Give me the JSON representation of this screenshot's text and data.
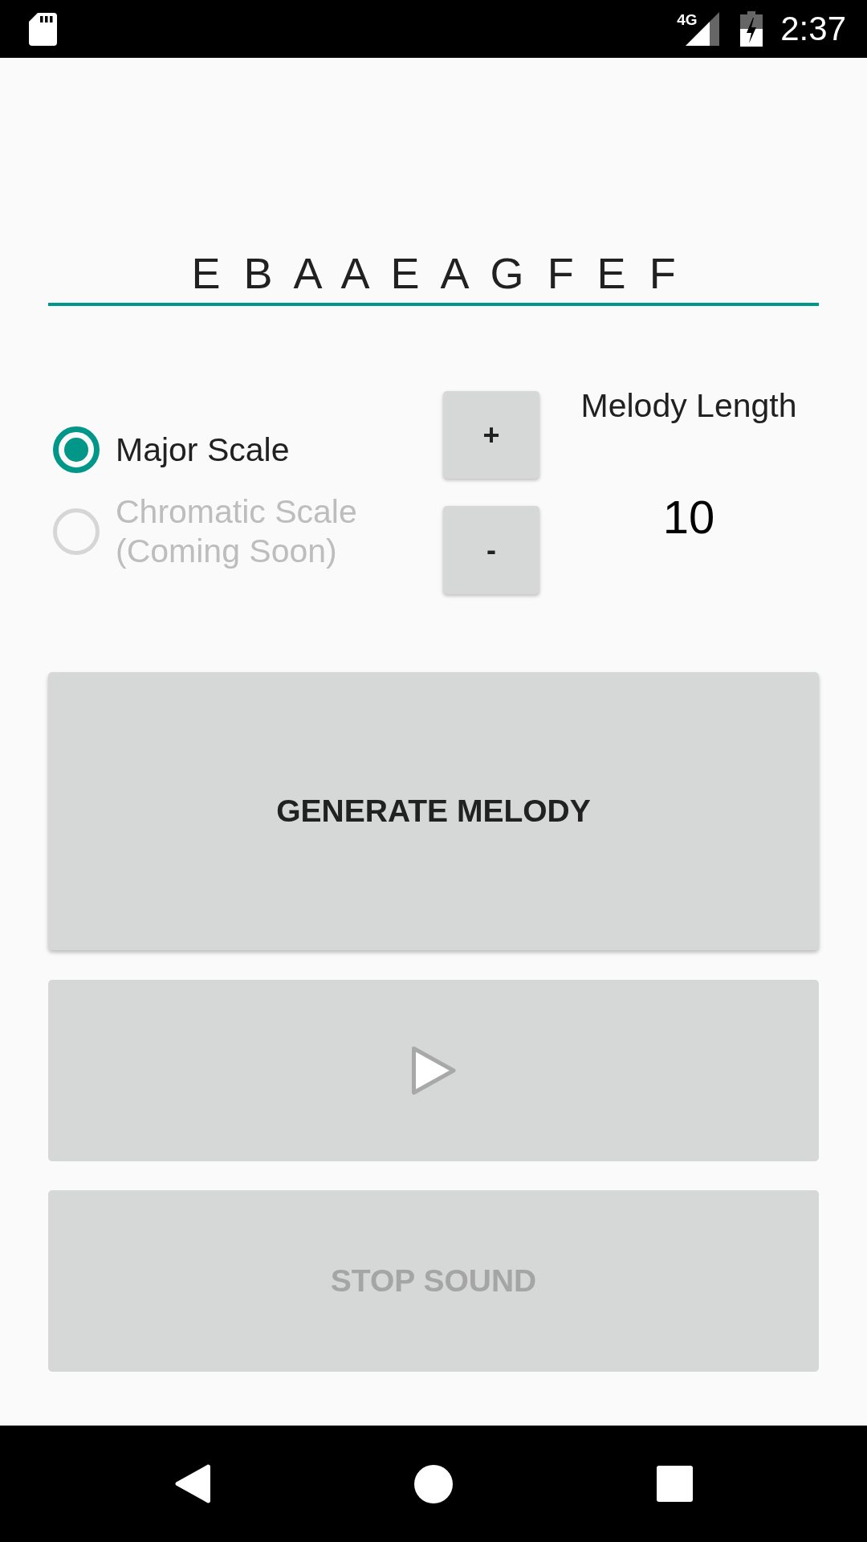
{
  "status_bar": {
    "network": "4G",
    "time": "2:37"
  },
  "melody_field": {
    "value": "E B A A E A G F E F"
  },
  "scale_options": [
    {
      "label": "Major Scale",
      "selected": true,
      "disabled": false
    },
    {
      "label": "Chromatic Scale (Coming Soon)",
      "selected": false,
      "disabled": true
    }
  ],
  "melody_length": {
    "increase_button": "+",
    "label": "Melody Length",
    "value": "10",
    "decrease_button": "-"
  },
  "generate_button": {
    "label": "GENERATE MELODY",
    "disabled": false
  },
  "play_button": {
    "disabled": true
  },
  "stop_button": {
    "label": "STOP SOUND",
    "disabled": true
  }
}
